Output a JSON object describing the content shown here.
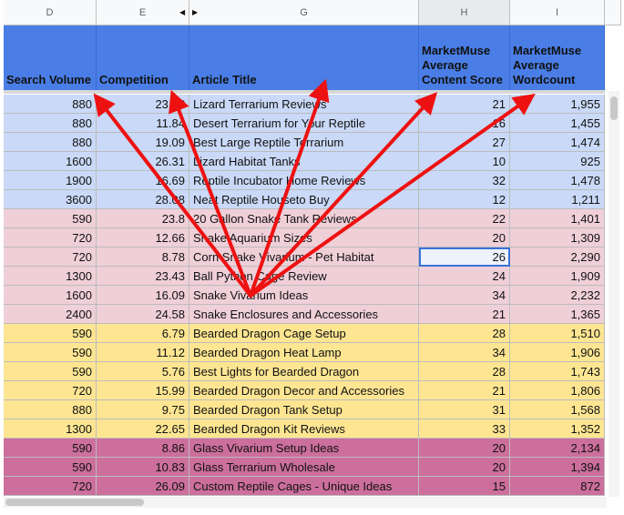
{
  "column_letters": [
    "D",
    "E",
    "G",
    "H",
    "I"
  ],
  "headers": [
    "Search Volume",
    "Competition",
    "Article Title",
    "MarketMuse Average Content Score",
    "MarketMuse Average Wordcount"
  ],
  "rows": [
    {
      "volume": "880",
      "competition": "23.??",
      "title": "Lizard Terrarium Reviews",
      "score": "21",
      "words": "1,955",
      "group": "blue"
    },
    {
      "volume": "880",
      "competition": "11.84",
      "title": "Desert Terrarium for Your Reptile",
      "score": "16",
      "words": "1,455",
      "group": "blue"
    },
    {
      "volume": "880",
      "competition": "19.09",
      "title": "Best Large Reptile Terrarium",
      "score": "27",
      "words": "1,474",
      "group": "blue"
    },
    {
      "volume": "1600",
      "competition": "26.31",
      "title": "Lizard Habitat Tanks",
      "score": "10",
      "words": "925",
      "group": "blue"
    },
    {
      "volume": "1900",
      "competition": "16.69",
      "title": "Reptile Incubator Home Reviews",
      "score": "32",
      "words": "1,478",
      "group": "blue"
    },
    {
      "volume": "3600",
      "competition": "28.08",
      "title": "Neat Reptile Houseto Buy",
      "score": "12",
      "words": "1,211",
      "group": "blue"
    },
    {
      "volume": "590",
      "competition": "23.8",
      "title": "20 Gallon Snake Tank Reviews",
      "score": "22",
      "words": "1,401",
      "group": "pink"
    },
    {
      "volume": "720",
      "competition": "12.66",
      "title": "Snake Aquarium Sizes",
      "score": "20",
      "words": "1,309",
      "group": "pink"
    },
    {
      "volume": "720",
      "competition": "8.78",
      "title": "Corn Snake Vivarium - Pet Habitat",
      "score": "26",
      "words": "2,290",
      "group": "pink"
    },
    {
      "volume": "1300",
      "competition": "23.43",
      "title": "Ball Python Cage Review",
      "score": "24",
      "words": "1,909",
      "group": "pink"
    },
    {
      "volume": "1600",
      "competition": "16.09",
      "title": "Snake Vivarium Ideas",
      "score": "34",
      "words": "2,232",
      "group": "pink"
    },
    {
      "volume": "2400",
      "competition": "24.58",
      "title": "Snake Enclosures and Accessories",
      "score": "21",
      "words": "1,365",
      "group": "pink"
    },
    {
      "volume": "590",
      "competition": "6.79",
      "title": "Bearded Dragon Cage Setup",
      "score": "28",
      "words": "1,510",
      "group": "yellow"
    },
    {
      "volume": "590",
      "competition": "11.12",
      "title": "Bearded Dragon Heat Lamp",
      "score": "34",
      "words": "1,906",
      "group": "yellow"
    },
    {
      "volume": "590",
      "competition": "5.76",
      "title": "Best Lights for Bearded Dragon",
      "score": "28",
      "words": "1,743",
      "group": "yellow"
    },
    {
      "volume": "720",
      "competition": "15.99",
      "title": "Bearded Dragon Decor and Accessories",
      "score": "21",
      "words": "1,806",
      "group": "yellow"
    },
    {
      "volume": "880",
      "competition": "9.75",
      "title": "Bearded Dragon Tank Setup",
      "score": "31",
      "words": "1,568",
      "group": "yellow"
    },
    {
      "volume": "1300",
      "competition": "22.65",
      "title": "Bearded Dragon Kit Reviews",
      "score": "33",
      "words": "1,352",
      "group": "yellow"
    },
    {
      "volume": "590",
      "competition": "8.86",
      "title": "Glass Vivarium Setup Ideas",
      "score": "20",
      "words": "2,134",
      "group": "magenta"
    },
    {
      "volume": "590",
      "competition": "10.83",
      "title": "Glass Terrarium Wholesale",
      "score": "20",
      "words": "1,394",
      "group": "magenta"
    },
    {
      "volume": "720",
      "competition": "26.09",
      "title": "Custom Reptile Cages - Unique Ideas",
      "score": "15",
      "words": "872",
      "group": "magenta"
    }
  ],
  "active_cell": {
    "row": 8,
    "column": "H"
  },
  "annotation_color": "#ee1111"
}
